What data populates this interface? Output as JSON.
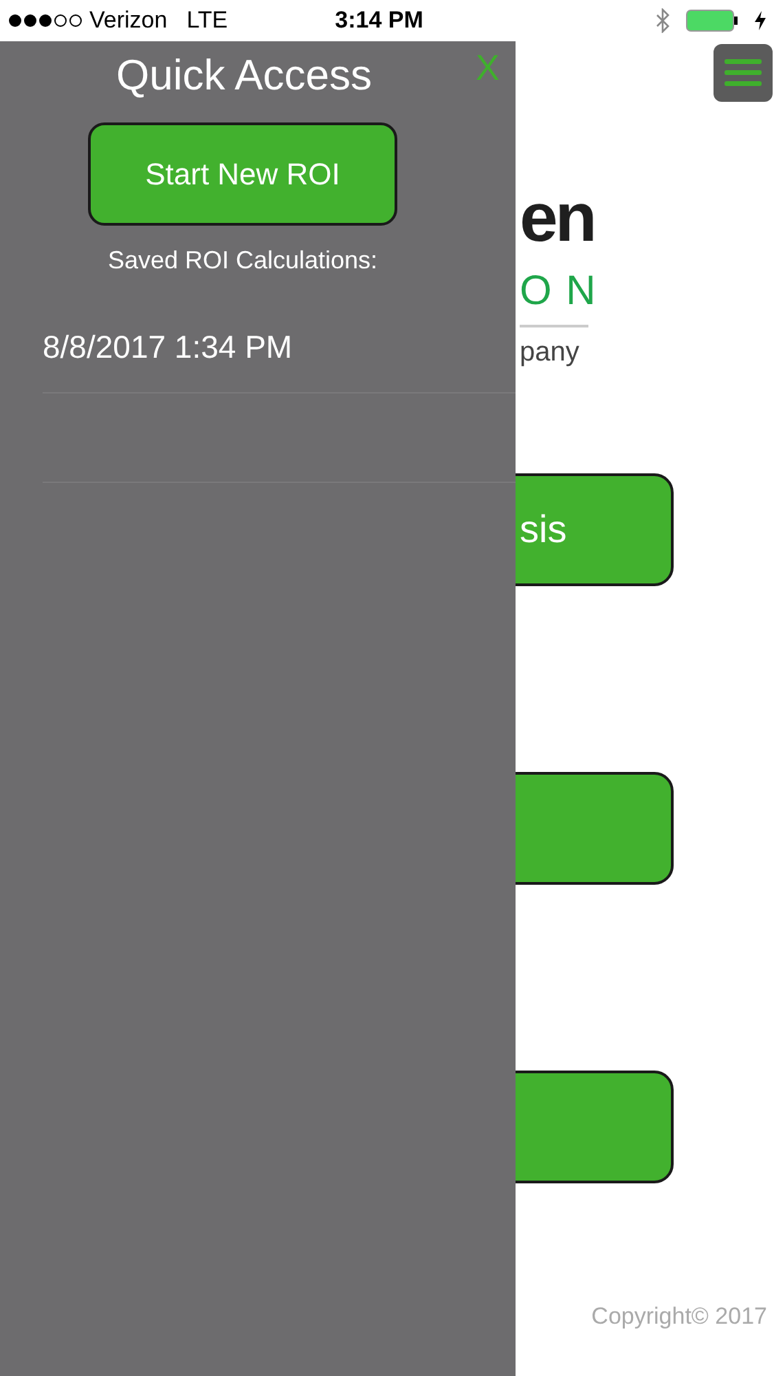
{
  "status_bar": {
    "carrier": "Verizon",
    "network": "LTE",
    "time": "3:14 PM"
  },
  "page": {
    "logo_parts": [
      "en",
      "O N",
      "pany"
    ],
    "buttons": [
      {
        "kind": "labeled",
        "label": "sis"
      },
      {
        "kind": "blank"
      },
      {
        "kind": "blank"
      }
    ],
    "copyright": "Copyright© 2017"
  },
  "drawer": {
    "title": "Quick Access",
    "close_label": "X",
    "primary_button": "Start New ROI",
    "section_label": "Saved ROI Calculations:",
    "saved_items": [
      {
        "label": "8/8/2017 1:34 PM"
      }
    ]
  }
}
